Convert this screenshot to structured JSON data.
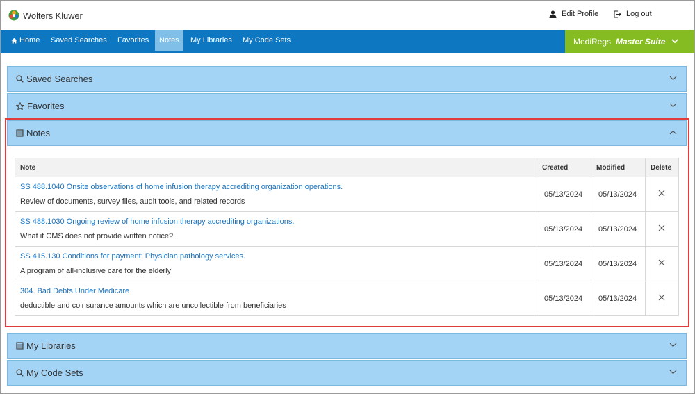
{
  "header": {
    "brand": "Wolters Kluwer",
    "edit_profile": "Edit Profile",
    "log_out": "Log out"
  },
  "nav": {
    "items": [
      {
        "label": "Home",
        "icon": "home-icon"
      },
      {
        "label": "Saved Searches"
      },
      {
        "label": "Favorites"
      },
      {
        "label": "Notes",
        "active": true
      },
      {
        "label": "My Libraries"
      },
      {
        "label": "My Code Sets"
      }
    ],
    "suite_brand": "MediRegs",
    "suite_edition": "Master Suite"
  },
  "panels": {
    "saved_searches": {
      "title": "Saved Searches",
      "icon": "search-icon"
    },
    "favorites": {
      "title": "Favorites",
      "icon": "star-icon"
    },
    "notes": {
      "title": "Notes",
      "icon": "note-icon"
    },
    "my_libraries": {
      "title": "My Libraries",
      "icon": "library-icon"
    },
    "my_code_sets": {
      "title": "My Code Sets",
      "icon": "search-icon"
    }
  },
  "notes_table": {
    "columns": [
      "Note",
      "Created",
      "Modified",
      "Delete"
    ],
    "rows": [
      {
        "title": "SS 488.1040 Onsite observations of home infusion therapy accrediting organization operations.",
        "description": "Review of documents, survey files, audit tools, and related records",
        "created": "05/13/2024",
        "modified": "05/13/2024"
      },
      {
        "title": "SS 488.1030 Ongoing review of home infusion therapy accrediting organizations.",
        "description": "What if CMS does not provide written notice?",
        "created": "05/13/2024",
        "modified": "05/13/2024"
      },
      {
        "title": "SS 415.130 Conditions for payment: Physician pathology services.",
        "description": "A program of all-inclusive care for the elderly",
        "created": "05/13/2024",
        "modified": "05/13/2024"
      },
      {
        "title": "304. Bad Debts Under Medicare",
        "description": "deductible and coinsurance amounts which are uncollectible from beneficiaries",
        "created": "05/13/2024",
        "modified": "05/13/2024"
      }
    ]
  },
  "colors": {
    "nav_blue": "#0d77c2",
    "nav_active": "#80c0e8",
    "suite_green": "#85bc22",
    "panel_blue": "#a3d4f5",
    "link_blue": "#1a74c0",
    "highlight_red": "#e03c3c"
  }
}
